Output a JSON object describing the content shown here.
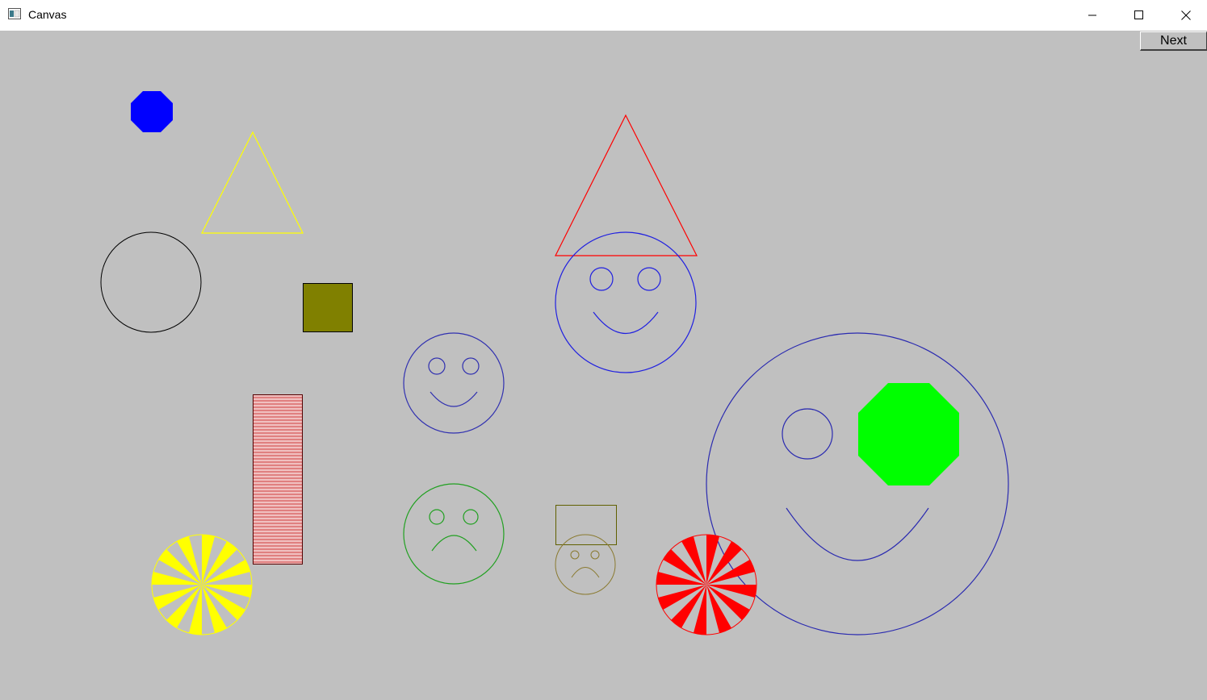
{
  "window": {
    "title": "Canvas",
    "controls": [
      "minimize-icon",
      "maximize-icon",
      "close-icon"
    ]
  },
  "toolbar": {
    "next_label": "Next"
  },
  "colors": {
    "canvas_bg": "#c0c0c0",
    "blue": "#0000ff",
    "yellow": "#ffff00",
    "red": "#ff0000",
    "olive": "#808000",
    "green": "#00ff00",
    "smiley_blue": "#2a2ab0",
    "sad_green": "#20a020",
    "striped_rect": "#d04040"
  }
}
